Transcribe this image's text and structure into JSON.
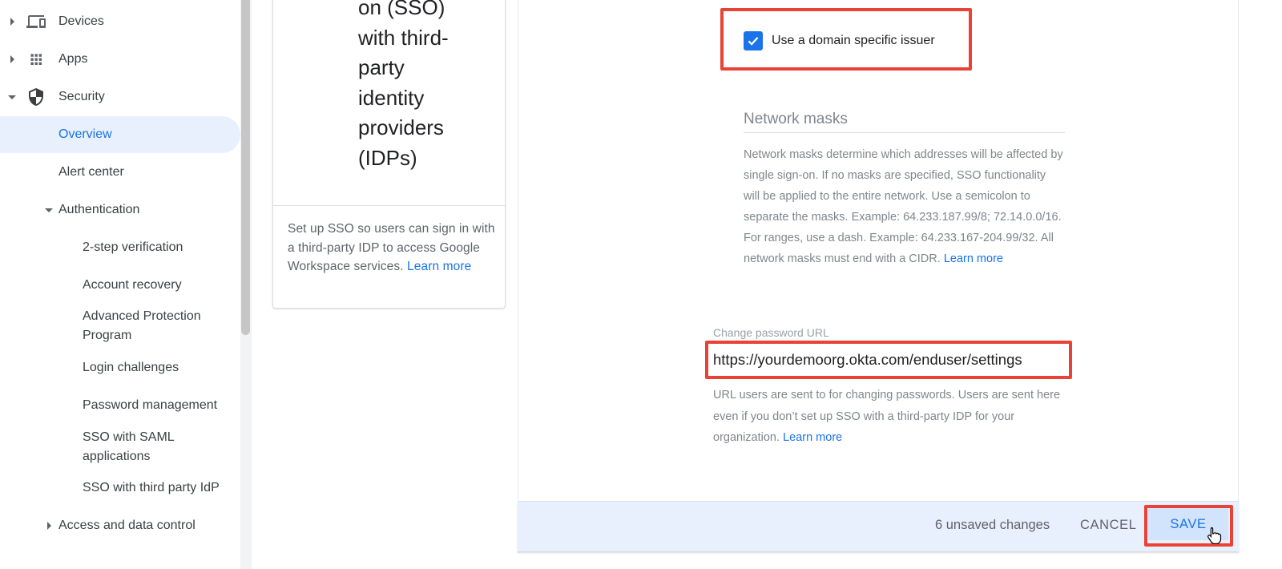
{
  "sidebar": {
    "items": [
      {
        "label": "Devices",
        "icon": "devices-icon",
        "expand": "collapsed"
      },
      {
        "label": "Apps",
        "icon": "apps-grid-icon",
        "expand": "collapsed"
      },
      {
        "label": "Security",
        "icon": "shield-icon",
        "expand": "expanded"
      },
      {
        "label": "Overview",
        "active": true
      },
      {
        "label": "Alert center"
      },
      {
        "label": "Authentication",
        "expand": "expanded"
      },
      {
        "label": "2-step verification"
      },
      {
        "label": "Account recovery"
      },
      {
        "label": "Advanced Protection Program"
      },
      {
        "label": "Login challenges"
      },
      {
        "label": "Password management"
      },
      {
        "label": "SSO with SAML applications"
      },
      {
        "label": "SSO with third party IdP"
      },
      {
        "label": "Access and data control",
        "expand": "collapsed"
      }
    ]
  },
  "card": {
    "title_lines": [
      "on (SSO)",
      "with third-",
      "party",
      "identity",
      "providers",
      "(IDPs)"
    ],
    "description": "Set up SSO so users can sign in with a third-party IDP to access Google Workspace services.",
    "learn_more": "Learn more"
  },
  "settings": {
    "domain_issuer": {
      "label": "Use a domain specific issuer",
      "checked": true
    },
    "network_masks": {
      "title": "Network masks",
      "description": "Network masks determine which addresses will be affected by single sign-on. If no masks are specified, SSO functionality will be applied to the entire network. Use a semicolon to separate the masks. Example: 64.233.187.99/8; 72.14.0.0/16. For ranges, use a dash. Example: 64.233.167-204.99/32. All network masks must end with a CIDR.",
      "learn_more": "Learn more"
    },
    "change_password": {
      "label": "Change password URL",
      "value": "https://yourdemoorg.okta.com/enduser/settings",
      "help": "URL users are sent to for changing passwords. Users are sent here even if you don’t set up SSO with a third-party IDP for your organization.",
      "learn_more": "Learn more"
    }
  },
  "footer": {
    "unsaved": "6 unsaved changes",
    "cancel": "CANCEL",
    "save": "SAVE"
  },
  "colors": {
    "accent": "#1a73e8",
    "highlight": "#ea4335",
    "footer_bg": "#e8f0fe"
  }
}
